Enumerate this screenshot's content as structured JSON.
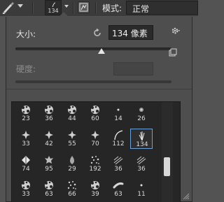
{
  "toolbar": {
    "brush_size": "134",
    "mode_label": "模式:",
    "mode_value": "正常"
  },
  "picker": {
    "size_label": "大小:",
    "size_value": "134 像素",
    "size_slider_fraction": 0.55,
    "hardness_label": "硬度:",
    "hardness_value": ""
  },
  "brushes": {
    "rows": [
      [
        {
          "size": "23",
          "kind": "splat"
        },
        {
          "size": "36",
          "kind": "splat"
        },
        {
          "size": "44",
          "kind": "splat"
        },
        {
          "size": "60",
          "kind": "splat"
        },
        {
          "size": "14",
          "kind": "dot"
        },
        {
          "size": "26",
          "kind": "soft"
        }
      ],
      [
        {
          "size": "33",
          "kind": "star"
        },
        {
          "size": "42",
          "kind": "star"
        },
        {
          "size": "55",
          "kind": "star"
        },
        {
          "size": "70",
          "kind": "star"
        },
        {
          "size": "112",
          "kind": "curve"
        },
        {
          "size": "134",
          "kind": "grass",
          "selected": true
        }
      ],
      [
        {
          "size": "74",
          "kind": "leaf"
        },
        {
          "size": "95",
          "kind": "maple"
        },
        {
          "size": "29",
          "kind": "drop"
        },
        {
          "size": "192",
          "kind": "scatter"
        },
        {
          "size": "36",
          "kind": "hatch"
        },
        {
          "size": "36",
          "kind": "hatch"
        }
      ],
      [
        {
          "size": "33",
          "kind": "splat"
        },
        {
          "size": "63",
          "kind": "splat"
        },
        {
          "size": "66",
          "kind": "scatter"
        },
        {
          "size": "39",
          "kind": "splat"
        },
        {
          "size": "63",
          "kind": "smudge"
        },
        {
          "size": "11",
          "kind": "dot"
        }
      ]
    ]
  }
}
